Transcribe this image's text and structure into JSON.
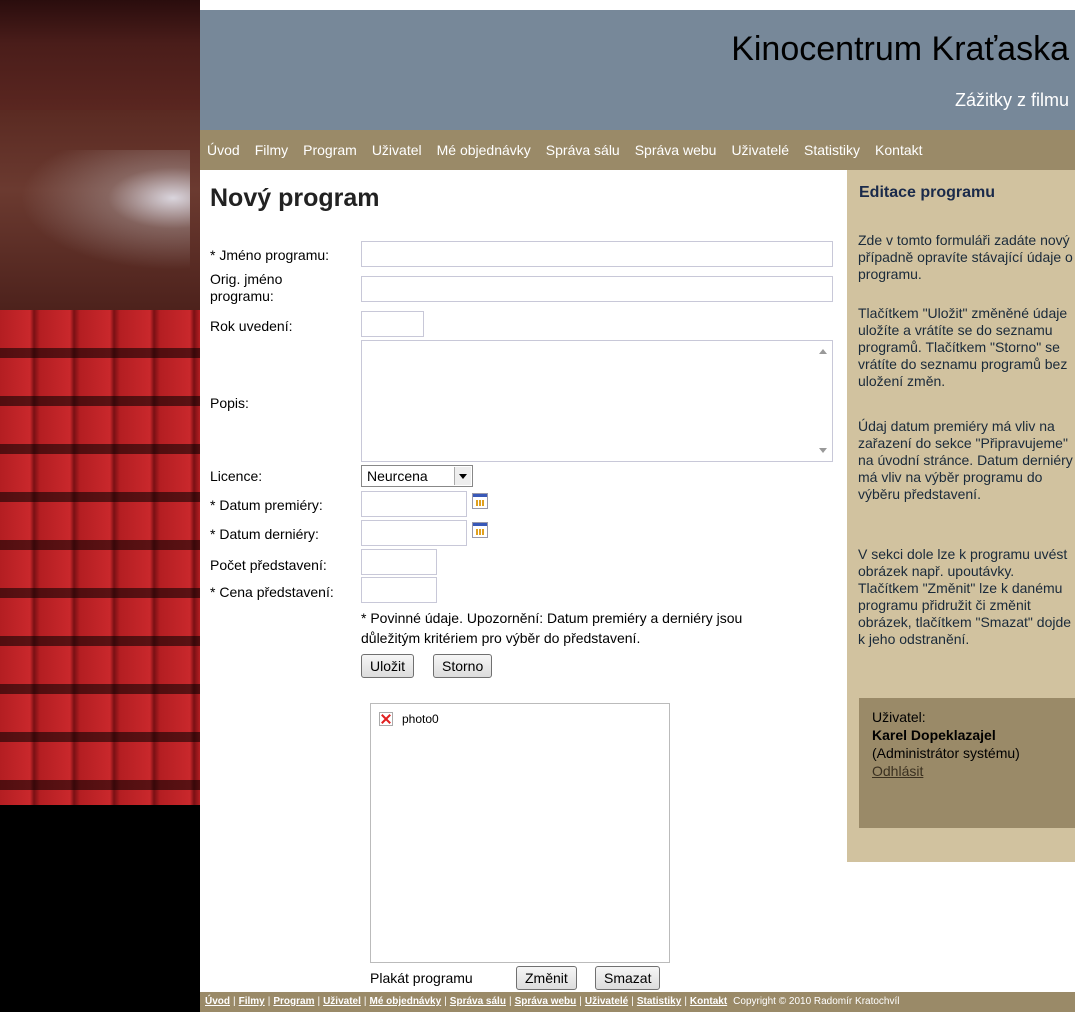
{
  "header": {
    "title": "Kinocentrum Kraťaska",
    "subtitle": "Zážitky z filmu"
  },
  "nav": {
    "items": [
      "Úvod",
      "Filmy",
      "Program",
      "Uživatel",
      "Mé objednávky",
      "Správa sálu",
      "Správa webu",
      "Uživatelé",
      "Statistiky",
      "Kontakt"
    ]
  },
  "form": {
    "page_title": "Nový program",
    "name_label": "* Jméno programu:",
    "name_value": "",
    "orig_name_label": "Orig. jméno programu:",
    "orig_name_value": "",
    "year_label": "Rok uvedení:",
    "year_value": "",
    "description_label": "Popis:",
    "description_value": "",
    "license_label": "Licence:",
    "license_value": "Neurcena",
    "premiere_label": "* Datum premiéry:",
    "premiere_value": "",
    "last_label": "* Datum derniéry:",
    "last_value": "",
    "count_label": "Počet představení:",
    "count_value": "",
    "price_label": "* Cena představení:",
    "price_value": "",
    "note": "* Povinné údaje. Upozornění: Datum premiéry a derniéry jsou důležitým kritériem pro výběr do představení.",
    "save_label": "Uložit",
    "cancel_label": "Storno"
  },
  "poster": {
    "image_name": "photo0",
    "label": "Plakát programu",
    "change_label": "Změnit",
    "delete_label": "Smazat"
  },
  "sidebar": {
    "title": "Editace programu",
    "p1": "Zde v tomto formuláři zadáte nový případně opravíte stávající údaje o programu.",
    "p2": "Tlačítkem \"Uložit\" změněné údaje uložíte a vrátíte se do seznamu programů. Tlačítkem \"Storno\" se vrátíte do seznamu programů bez uložení změn.",
    "p3": "Údaj datum premiéry má vliv na zařazení do sekce \"Připravujeme\" na úvodní stránce. Datum derniéry má vliv na výběr programu do výběru představení.",
    "p4": "V sekci dole lze k programu uvést obrázek např. upoutávky. Tlačítkem \"Změnit\" lze k danému programu přidružit či změnit obrázek, tlačítkem \"Smazat\" dojde k jeho odstranění.",
    "user_label": "Uživatel:",
    "user_name": "Karel Dopeklazajel",
    "user_role": "(Administrátor systému)",
    "logout": "Odhlásit"
  },
  "footer": {
    "links": [
      "Úvod",
      "Filmy",
      "Program",
      "Uživatel",
      "Mé objednávky",
      "Správa sálu",
      "Správa webu",
      "Uživatelé",
      "Statistiky",
      "Kontakt"
    ],
    "copyright": "Copyright © 2010 Radomír Kratochvíl"
  }
}
